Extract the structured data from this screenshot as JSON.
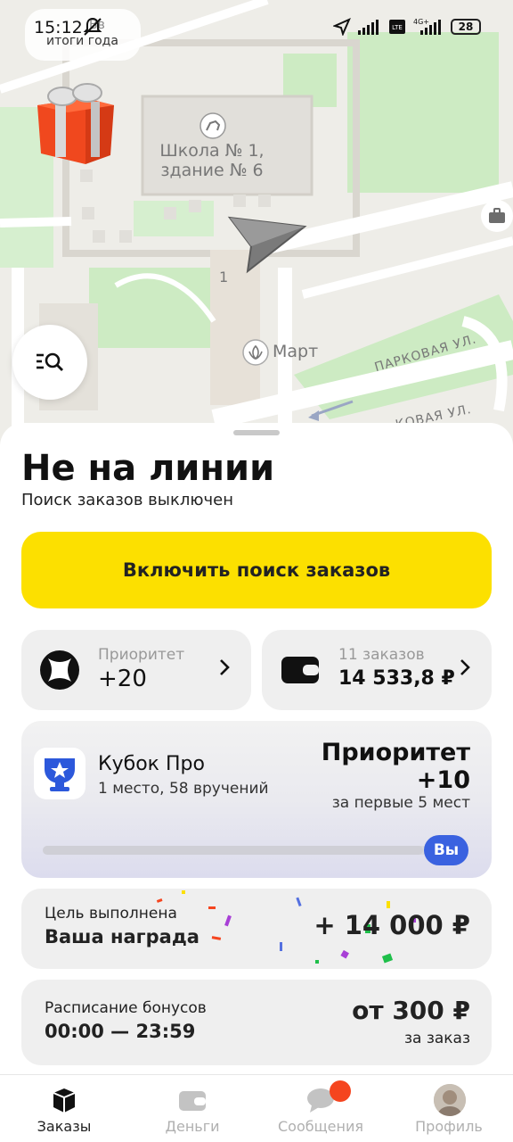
{
  "status_bar": {
    "time": "15:12",
    "network": "4G+",
    "battery": "28",
    "volte": "Vo LTE"
  },
  "promo": {
    "line1": "Вв",
    "line2": "итоги года"
  },
  "map": {
    "school_label_1": "Школа № 1,",
    "school_label_2": "здание № 6",
    "house_number": "1",
    "shop_label": "Март",
    "street_1": "ПАРКОВАЯ УЛ.",
    "street_2": "КОВАЯ УЛ."
  },
  "driver_status": {
    "title": "Не на линии",
    "subtitle": "Поиск заказов выключен",
    "toggle_button": "Включить поиск заказов"
  },
  "priority_card": {
    "label": "Приоритет",
    "value": "+20"
  },
  "orders_card": {
    "label": "11 заказов",
    "value": "14 533,8 ₽"
  },
  "cup_card": {
    "title": "Кубок Про",
    "subtitle": "1 место, 58 вручений",
    "priority_title": "Приоритет",
    "priority_value": "+10",
    "note": "за первые 5 мест",
    "you_badge": "Вы",
    "progress": 0.97
  },
  "goal_card": {
    "line1": "Цель выполнена",
    "line2": "Ваша награда",
    "amount": "+ 14 000 ₽"
  },
  "bonus_card": {
    "line1": "Расписание бонусов",
    "line2": "00:00 — 23:59",
    "amount": "от 300 ₽",
    "per": "за заказ"
  },
  "tabs": [
    {
      "label": "Заказы",
      "icon": "box-icon",
      "active": true
    },
    {
      "label": "Деньги",
      "icon": "wallet-icon",
      "active": false
    },
    {
      "label": "Сообщения",
      "icon": "chat-icon",
      "active": false
    },
    {
      "label": "Профиль",
      "icon": "avatar",
      "active": false
    }
  ],
  "colors": {
    "accent_yellow": "#fce000",
    "badge_blue": "#3a62e0",
    "notification_red": "#f5451f"
  }
}
